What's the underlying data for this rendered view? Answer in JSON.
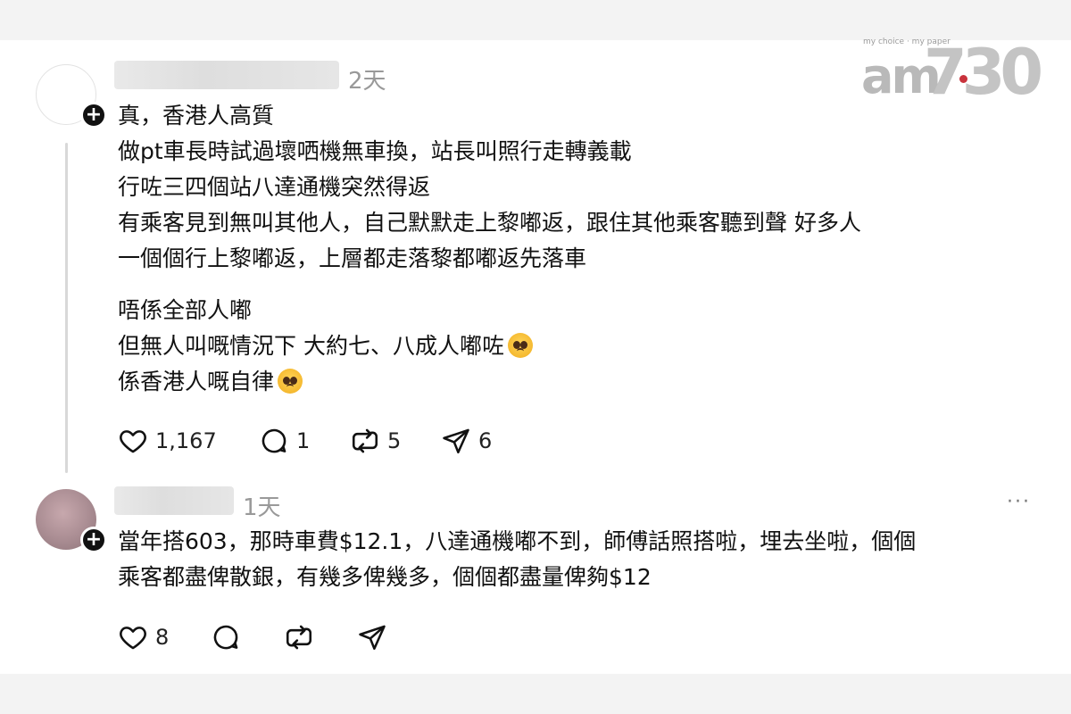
{
  "logo": {
    "brand": "am",
    "number": "730",
    "tagline": "my choice · my paper"
  },
  "posts": [
    {
      "time": "2天",
      "lines": [
        "真，香港人高質",
        "做pt車長時試過壞哂機無車換，站長叫照行走轉￼義載",
        "行咗三四個站八達通機突然得返",
        "有乘客￼見到無叫其他人，自己默默走上黎嘟返，跟住其他乘客￼聽到聲 好多人",
        "一個個行上黎嘟返，上層都走落黎都嘟返先落車",
        "唔係全部人嘟",
        "但無人叫嘅情況下 大約七、八成人嘟咗",
        "係香港人嘅自律"
      ],
      "emoji": "pleading-face",
      "likes": "1,167",
      "replies": "1",
      "reposts": "5",
      "shares": "6"
    },
    {
      "time": "1天",
      "more": "···",
      "lines": [
        "當年搭603，那時車費$12.1，八達通機嘟不到，師傅話照搭啦，埋去坐啦，個個",
        "乘客都盡俾散銀，有幾多俾幾多，個個都盡量俾夠$12"
      ],
      "likes": "8",
      "replies": "",
      "reposts": "",
      "shares": ""
    }
  ],
  "follow_symbol": "+"
}
